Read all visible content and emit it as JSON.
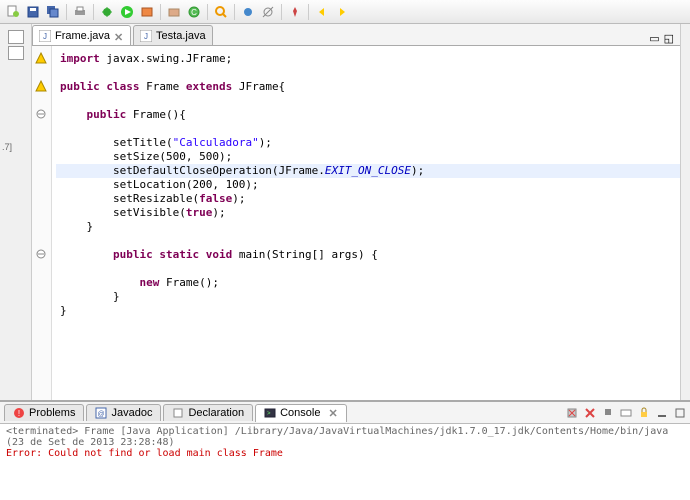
{
  "toolbar": {
    "icons": [
      "new",
      "save",
      "open",
      "print",
      "debug",
      "run",
      "run-ext",
      "package",
      "search",
      "step-over",
      "step-into",
      "debug2",
      "tag",
      "nav-back",
      "nav-fwd"
    ]
  },
  "leftbar": {
    "label": ".7]"
  },
  "tabs": [
    {
      "label": "Frame.java",
      "active": true
    },
    {
      "label": "Testa.java",
      "active": false
    }
  ],
  "code": {
    "lines": [
      {
        "t": "import",
        "rest": " javax.swing.JFrame;"
      },
      {
        "blank": true
      },
      {
        "t": "public class",
        "name": " Frame ",
        "t2": "extends",
        "rest": " JFrame{"
      },
      {
        "blank": true
      },
      {
        "indent": 1,
        "t": "public",
        "rest": " Frame(){"
      },
      {
        "blank": true
      },
      {
        "indent": 2,
        "call": "setTitle(",
        "str": "\"Calculadora\"",
        "end": ");"
      },
      {
        "indent": 2,
        "call": "setSize(500, 500);"
      },
      {
        "indent": 2,
        "hl": true,
        "call": "setDefaultCloseOperation(JFrame.",
        "field": "EXIT_ON_CLOSE",
        "end": ");"
      },
      {
        "indent": 2,
        "call": "setLocation(200, 100);"
      },
      {
        "indent": 2,
        "call": "setResizable(",
        "kw": "false",
        "end": ");"
      },
      {
        "indent": 2,
        "call": "setVisible(",
        "kw": "true",
        "end": ");"
      },
      {
        "indent": 1,
        "call": "}"
      },
      {
        "blank": true
      },
      {
        "indent": 2,
        "t": "public static void",
        "rest": " main(String[] args) {"
      },
      {
        "blank": true
      },
      {
        "indent": 3,
        "t": "new",
        "rest": " Frame();"
      },
      {
        "indent": 2,
        "call": "}"
      },
      {
        "call": "}"
      }
    ]
  },
  "bottomTabs": [
    {
      "label": "Problems",
      "icon": "problems-icon"
    },
    {
      "label": "Javadoc",
      "icon": "javadoc-icon"
    },
    {
      "label": "Declaration",
      "icon": "declaration-icon"
    },
    {
      "label": "Console",
      "icon": "console-icon",
      "active": true
    }
  ],
  "console": {
    "terminated": "<terminated> Frame [Java Application] /Library/Java/JavaVirtualMachines/jdk1.7.0_17.jdk/Contents/Home/bin/java (23 de Set de 2013 23:28:48)",
    "error": "Error: Could not find or load main class Frame"
  },
  "colors": {
    "keyword": "#7f0055",
    "string": "#2a00ff",
    "field": "#0000c0",
    "error": "#cc0000"
  }
}
